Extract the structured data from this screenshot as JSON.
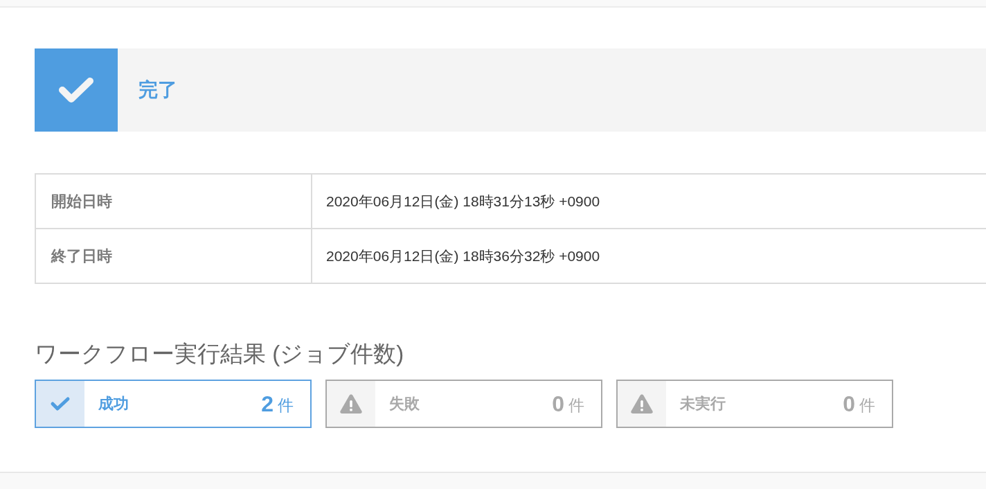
{
  "status": {
    "kind": "complete",
    "label": "完了"
  },
  "details": [
    {
      "label": "開始日時",
      "value": "2020年06月12日(金) 18時31分13秒 +0900"
    },
    {
      "label": "終了日時",
      "value": "2020年06月12日(金) 18時36分32秒 +0900"
    }
  ],
  "results_heading": "ワークフロー実行結果 (ジョブ件数)",
  "results": [
    {
      "kind": "success",
      "label": "成功",
      "count": "2",
      "unit": "件"
    },
    {
      "kind": "failure",
      "label": "失敗",
      "count": "0",
      "unit": "件"
    },
    {
      "kind": "not_run",
      "label": "未実行",
      "count": "0",
      "unit": "件"
    }
  ]
}
